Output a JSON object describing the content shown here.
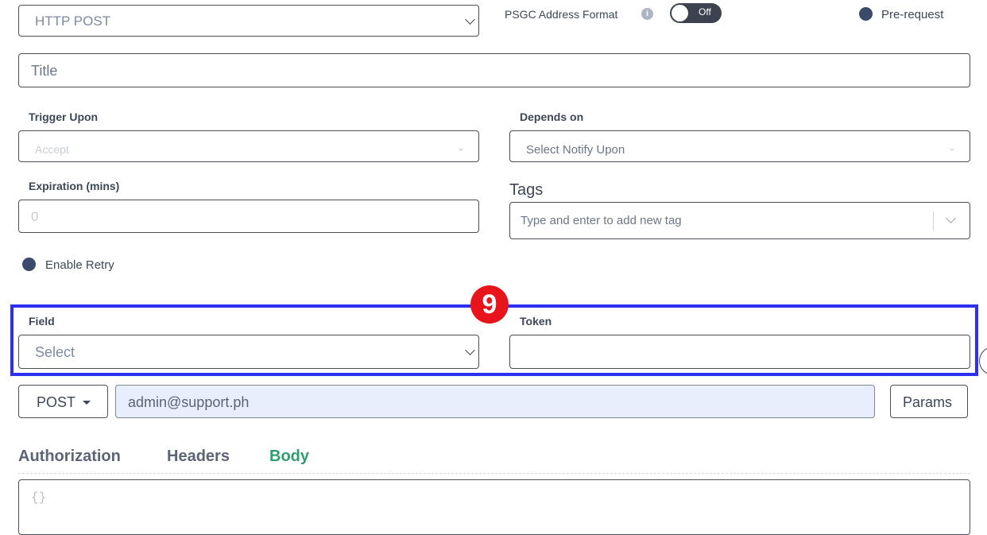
{
  "method_select": {
    "value": "HTTP POST"
  },
  "psgc": {
    "label": "PSGC Address Format",
    "toggle_state": "Off"
  },
  "pre_request": {
    "label": "Pre-request"
  },
  "title_input": {
    "placeholder": "Title"
  },
  "trigger": {
    "label": "Trigger Upon",
    "value": "Accept"
  },
  "depends": {
    "label": "Depends on",
    "value": "Select Notify Upon"
  },
  "expiration": {
    "label": "Expiration (mins)",
    "placeholder": "0"
  },
  "tags": {
    "label": "Tags",
    "placeholder": "Type and enter to add new tag"
  },
  "retry": {
    "label": "Enable Retry"
  },
  "callout": {
    "number": "9",
    "color": "#e8141b",
    "frame_color": "#2b2ff0"
  },
  "field": {
    "label": "Field",
    "value": "Select"
  },
  "token": {
    "label": "Token",
    "value": ""
  },
  "request": {
    "method": "POST",
    "url": "admin@support.ph",
    "params_label": "Params"
  },
  "tabs": [
    {
      "label": "Authorization",
      "active": false
    },
    {
      "label": "Headers",
      "active": false
    },
    {
      "label": "Body",
      "active": true
    }
  ],
  "body_editor": {
    "content": "{}"
  },
  "colors": {
    "accent_green": "#2e9e6e",
    "url_bg": "#e8eefb",
    "dot": "#3a4a6b"
  }
}
